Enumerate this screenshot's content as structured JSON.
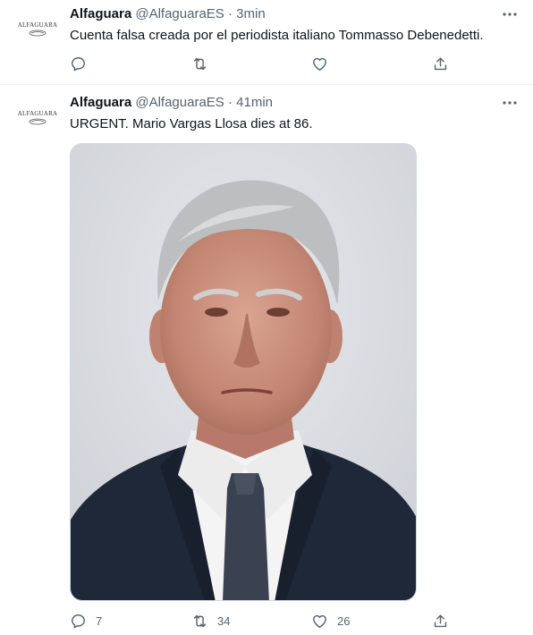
{
  "tweets": [
    {
      "name": "Alfaguara",
      "handle": "@AlfaguaraES",
      "separator": "·",
      "time": "3min",
      "text": "Cuenta falsa creada por el periodista italiano Tommasso Debenedetti.",
      "avatar_text": "ALFAGUARA",
      "counts": {
        "reply": "",
        "retweet": "",
        "like": ""
      }
    },
    {
      "name": "Alfaguara",
      "handle": "@AlfaguaraES",
      "separator": "·",
      "time": "41min",
      "text": "URGENT. Mario Vargas Llosa dies at 86.",
      "avatar_text": "ALFAGUARA",
      "counts": {
        "reply": "7",
        "retweet": "34",
        "like": "26"
      }
    }
  ],
  "icons": {
    "more": "more-horizontal-icon",
    "reply": "reply-icon",
    "retweet": "retweet-icon",
    "like": "heart-icon",
    "share": "share-icon"
  },
  "colors": {
    "text": "#0f1419",
    "secondary": "#536471",
    "divider": "#eff3f4"
  }
}
